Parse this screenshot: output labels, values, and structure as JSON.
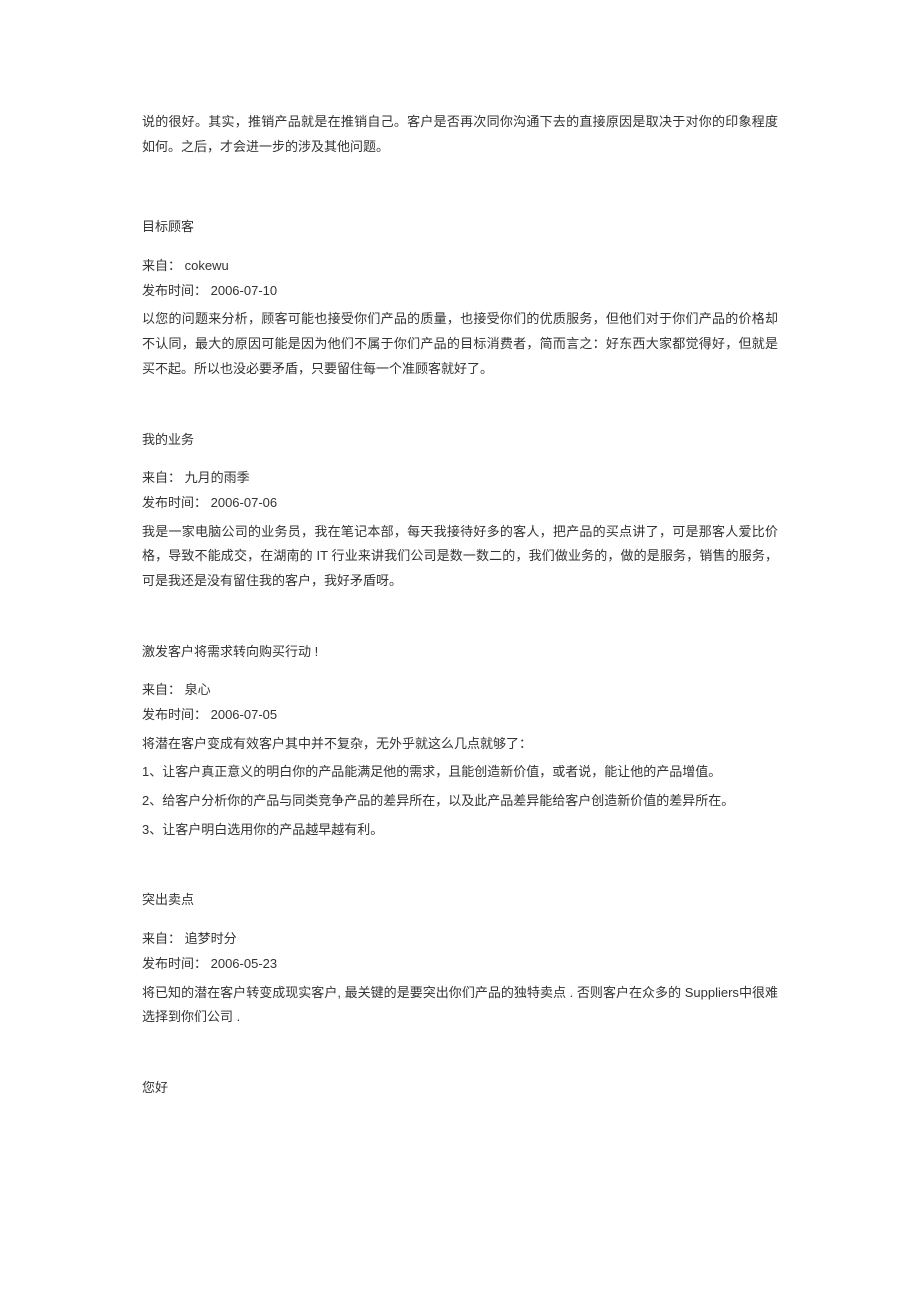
{
  "intro": "说的很好。其实，推销产品就是在推销自己。客户是否再次同你沟通下去的直接原因是取决于对你的印象程度如何。之后，才会进一步的涉及其他问题。",
  "labels": {
    "from_prefix": " 来自：   ",
    "date_prefix": "发布时间：   "
  },
  "posts": [
    {
      "title": " 目标顾客",
      "from": "cokewu",
      "date": "2006-07-10",
      "paragraphs": [
        "以您的问题来分析，顾客可能也接受你们产品的质量，也接受你们的优质服务，但他们对于你们产品的价格却不认同，最大的原因可能是因为他们不属于你们产品的目标消费者，简而言之：好东西大家都觉得好，但就是买不起。所以也没必要矛盾，只要留住每一个准顾客就好了。"
      ]
    },
    {
      "title": " 我的业务",
      "from": "九月的雨季",
      "date": "2006-07-06",
      "paragraphs": [
        "我是一家电脑公司的业务员，我在笔记本部，每天我接待好多的客人，把产品的买点讲了，可是那客人爱比价格，导致不能成交，在湖南的 IT 行业来讲我们公司是数一数二的，我们做业务的，做的是服务，销售的服务，可是我还是没有留住我的客户，我好矛盾呀。"
      ]
    },
    {
      "title": " 激发客户将需求转向购买行动 !",
      "from": "泉心",
      "date": "2006-07-05",
      "paragraphs": [
        "将潜在客户变成有效客户其中并不复杂，无外乎就这么几点就够了：",
        "1、让客户真正意义的明白你的产品能满足他的需求，且能创造新价值，或者说，能让他的产品增值。",
        "2、给客户分析你的产品与同类竞争产品的差异所在，以及此产品差异能给客户创造新价值的差异所在。",
        "3、让客户明白选用你的产品越早越有利。"
      ]
    },
    {
      "title": " 突出卖点",
      "from": "追梦时分",
      "date": "2006-05-23",
      "paragraphs": [
        "将已知的潜在客户转变成现实客户, 最关键的是要突出你们产品的独特卖点 . 否则客户在众多的 Suppliers中很难选择到你们公司 ."
      ]
    },
    {
      "title": " 您好",
      "from": null,
      "date": null,
      "paragraphs": []
    }
  ]
}
